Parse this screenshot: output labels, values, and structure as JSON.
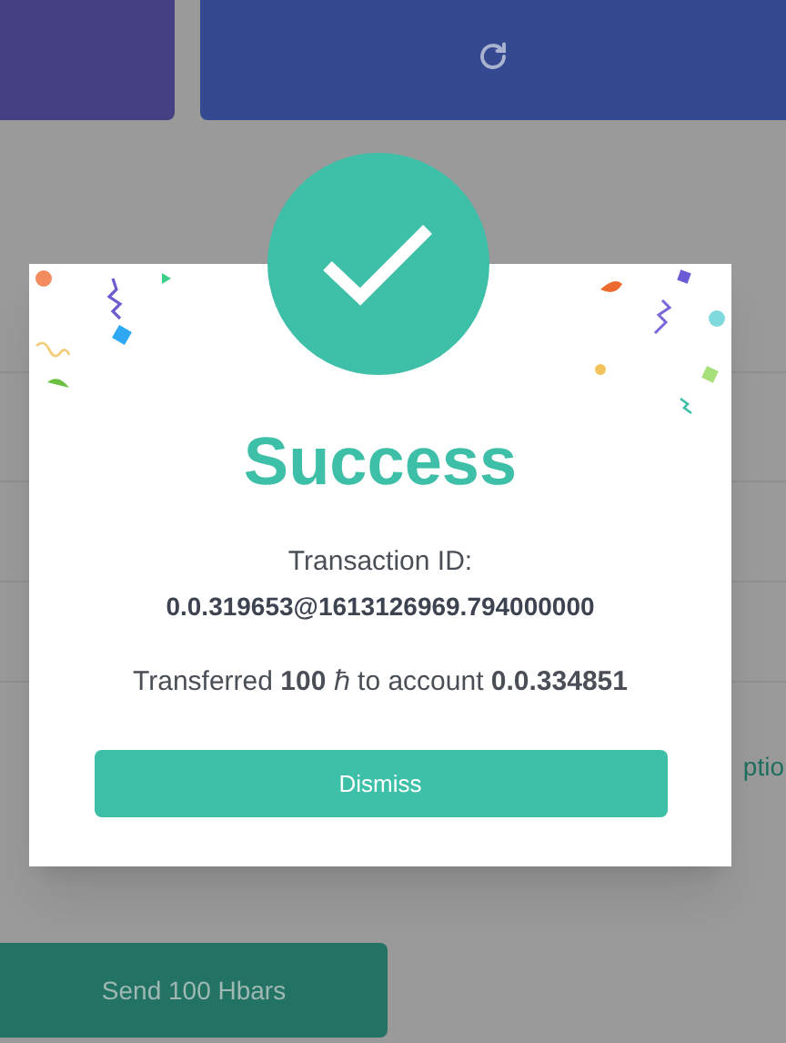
{
  "background": {
    "side_link": "ptio",
    "send_button": "Send 100 Hbars"
  },
  "dialog": {
    "title": "Success",
    "id_label": "Transaction ID:",
    "transaction_id": "0.0.319653@1613126969.794000000",
    "transfer_message": "Transferred **100** ℏ to account **0.0.334851**",
    "button": "Dismiss"
  }
}
